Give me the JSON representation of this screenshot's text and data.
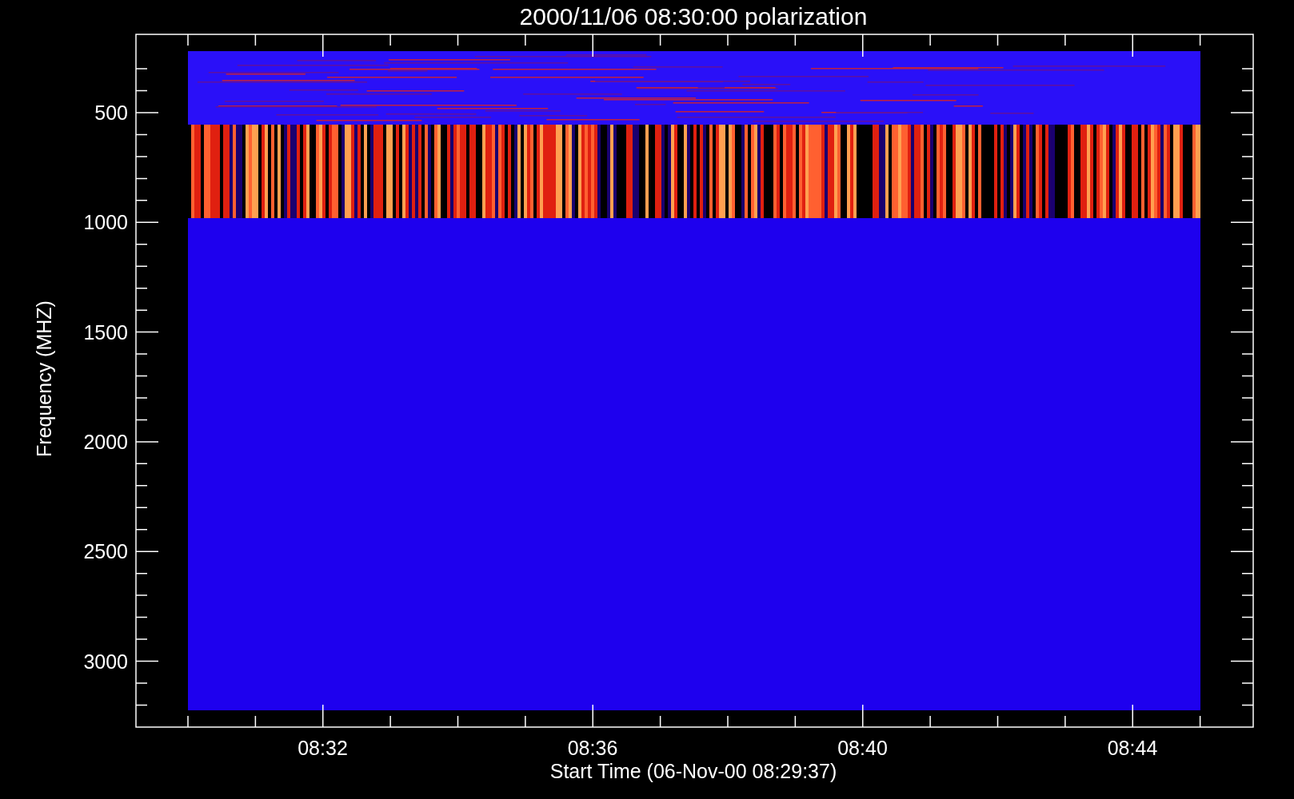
{
  "title": "2000/11/06 08:30:00 polarization",
  "y_axis": {
    "label": "Frequency (MHZ)",
    "ticks": [
      "500",
      "1000",
      "1500",
      "2000",
      "2500",
      "3000"
    ]
  },
  "x_axis": {
    "label": "Start Time (06-Nov-00 08:29:37)",
    "ticks": [
      "08:32",
      "08:36",
      "08:40",
      "08:44"
    ]
  }
}
